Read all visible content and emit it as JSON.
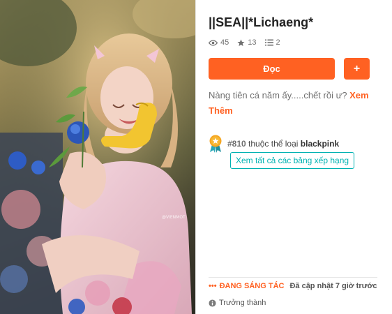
{
  "story": {
    "title": "||SEA||*Lichaeng*",
    "views": "45",
    "votes": "13",
    "parts": "2",
    "description": "Nàng tiên cá năm ấy.....chết rồi ư?",
    "see_more": "Xem Thêm"
  },
  "actions": {
    "read_label": "Đọc",
    "add_label": "+"
  },
  "ranking": {
    "rank": "#810",
    "in_category_text": "thuộc thể loại",
    "category": "blackpink",
    "see_all_label": "Xem tất cả các bảng xếp hạng"
  },
  "status": {
    "dots": "•••",
    "label": "ĐANG SÁNG TÁC",
    "updated": "Đã cập nhật 7 giờ trước"
  },
  "rating": {
    "label": "Trưởng thành"
  },
  "cover": {
    "watermark": "@VIENMOT"
  },
  "colors": {
    "accent": "#ff6122",
    "teal": "#00b2b2",
    "badge": "#f5a623"
  },
  "icons": {
    "views": "eye-icon",
    "votes": "star-icon",
    "parts": "list-icon",
    "rank": "ranking-badge-icon",
    "mature": "info-icon"
  }
}
